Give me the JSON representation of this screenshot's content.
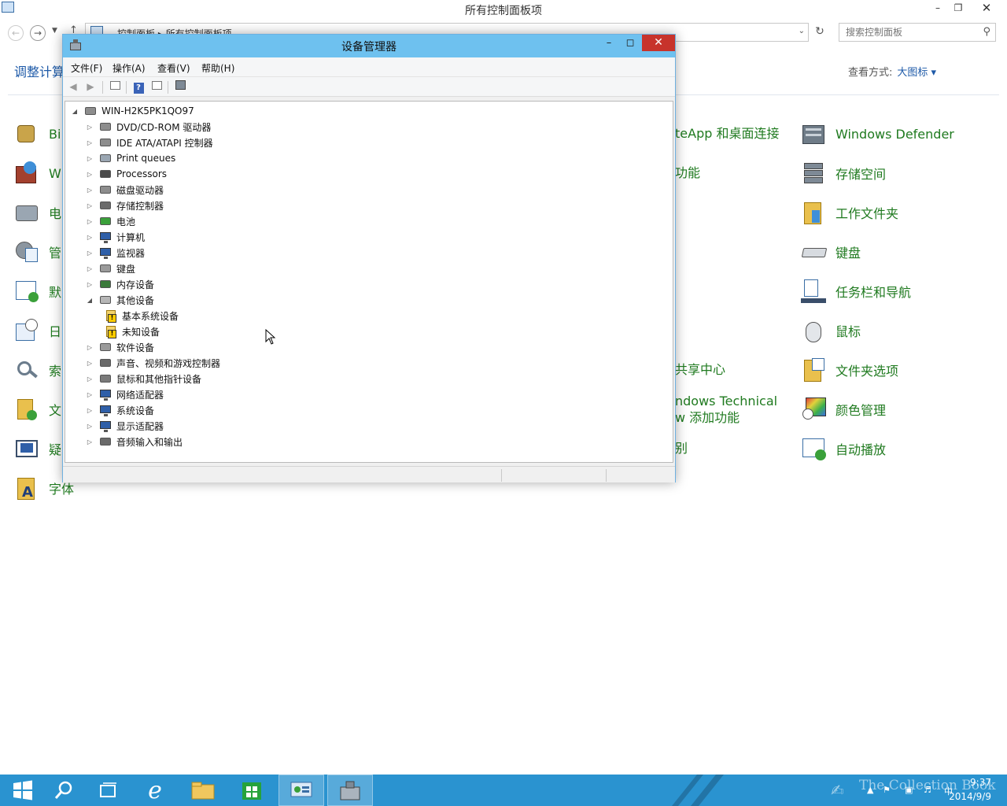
{
  "control_panel": {
    "window_title": "所有控制面板项",
    "breadcrumb": "控制面板  ▸  所有控制面板项",
    "search_placeholder": "搜索控制面板",
    "heading": "调整计算",
    "view_by_label": "查看方式:",
    "view_by_value": "大图标 ▾",
    "left_fragments": [
      "Bi",
      "W",
      "电",
      "管",
      "默",
      "日",
      "索",
      "文",
      "疑",
      "字体"
    ],
    "middle_fragments": [
      "teApp 和桌面连接",
      "功能",
      "共享中心",
      "ndows Technical",
      "w 添加功能",
      "别"
    ],
    "right_items": [
      {
        "label": "Windows Defender",
        "icon": "windows-defender-icon"
      },
      {
        "label": "存储空间",
        "icon": "storage-spaces-icon"
      },
      {
        "label": "工作文件夹",
        "icon": "work-folders-icon"
      },
      {
        "label": "键盘",
        "icon": "keyboard-icon"
      },
      {
        "label": "任务栏和导航",
        "icon": "taskbar-navigation-icon"
      },
      {
        "label": "鼠标",
        "icon": "mouse-icon"
      },
      {
        "label": "文件夹选项",
        "icon": "folder-options-icon"
      },
      {
        "label": "颜色管理",
        "icon": "color-management-icon"
      },
      {
        "label": "自动播放",
        "icon": "autoplay-icon"
      }
    ]
  },
  "device_manager": {
    "title": "设备管理器",
    "menus": [
      "文件(F)",
      "操作(A)",
      "查看(V)",
      "帮助(H)"
    ],
    "root": "WIN-H2K5PK1QO97",
    "nodes": [
      {
        "label": "DVD/CD-ROM 驱动器",
        "state": "collapsed",
        "icon": "dvd-drive-icon"
      },
      {
        "label": "IDE ATA/ATAPI 控制器",
        "state": "collapsed",
        "icon": "ide-controller-icon"
      },
      {
        "label": "Print queues",
        "state": "collapsed",
        "icon": "printer-icon"
      },
      {
        "label": "Processors",
        "state": "collapsed",
        "icon": "processor-icon"
      },
      {
        "label": "磁盘驱动器",
        "state": "collapsed",
        "icon": "disk-drive-icon"
      },
      {
        "label": "存储控制器",
        "state": "collapsed",
        "icon": "storage-controller-icon"
      },
      {
        "label": "电池",
        "state": "collapsed",
        "icon": "battery-icon"
      },
      {
        "label": "计算机",
        "state": "collapsed",
        "icon": "computer-icon"
      },
      {
        "label": "监视器",
        "state": "collapsed",
        "icon": "monitor-icon"
      },
      {
        "label": "键盘",
        "state": "collapsed",
        "icon": "keyboard-icon"
      },
      {
        "label": "内存设备",
        "state": "collapsed",
        "icon": "memory-icon"
      },
      {
        "label": "其他设备",
        "state": "expanded",
        "icon": "other-devices-icon"
      },
      {
        "label": "基本系统设备",
        "state": "child",
        "icon": "warning-device-icon"
      },
      {
        "label": "未知设备",
        "state": "child",
        "icon": "warning-device-icon"
      },
      {
        "label": "软件设备",
        "state": "collapsed",
        "icon": "software-device-icon"
      },
      {
        "label": "声音、视频和游戏控制器",
        "state": "collapsed",
        "icon": "speaker-icon"
      },
      {
        "label": "鼠标和其他指针设备",
        "state": "collapsed",
        "icon": "mouse-icon"
      },
      {
        "label": "网络适配器",
        "state": "collapsed",
        "icon": "network-adapter-icon"
      },
      {
        "label": "系统设备",
        "state": "collapsed",
        "icon": "system-device-icon"
      },
      {
        "label": "显示适配器",
        "state": "collapsed",
        "icon": "display-adapter-icon"
      },
      {
        "label": "音频输入和输出",
        "state": "collapsed",
        "icon": "audio-io-icon"
      }
    ]
  },
  "taskbar": {
    "apps": [
      "start-button",
      "search-icon",
      "task-view-icon",
      "internet-explorer-icon",
      "file-explorer-icon",
      "store-icon",
      "control-panel-icon",
      "device-manager-icon"
    ],
    "clock_time": "9:37",
    "clock_date": "2014/9/9",
    "watermark": "The Collection Book"
  },
  "colors": {
    "link_blue": "#1e5aa8",
    "item_green": "#1f7a1f",
    "titlebar_blue": "#6ec1ef",
    "close_red": "#c7332b",
    "taskbar_blue": "#2a93d0"
  }
}
